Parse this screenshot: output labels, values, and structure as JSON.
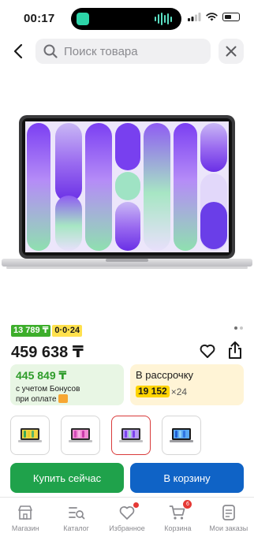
{
  "status_bar": {
    "time": "00:17"
  },
  "search": {
    "placeholder": "Поиск товара",
    "value": ""
  },
  "product": {
    "image_icon": "laptop-image",
    "badges": {
      "bonus_price": "13 789 ₸",
      "installment_plan": "0·0·24"
    },
    "gallery_pages": 2,
    "gallery_current": 1,
    "price": "459 638 ₸",
    "bonus_card": {
      "amount": "445 849 ₸",
      "line1": "с учетом Бонусов",
      "line2": "при оплате"
    },
    "installment_card": {
      "title": "В рассрочку",
      "monthly": "19 152",
      "months": "×24"
    },
    "variants": [
      {
        "name": "variant-1",
        "selected": false
      },
      {
        "name": "variant-2",
        "selected": false
      },
      {
        "name": "variant-3",
        "selected": true
      },
      {
        "name": "variant-4",
        "selected": false
      }
    ]
  },
  "actions": {
    "buy_now": "Купить сейчас",
    "add_to_cart": "В корзину"
  },
  "bottom_nav": [
    {
      "label": "Магазин",
      "icon": "store-icon"
    },
    {
      "label": "Каталог",
      "icon": "catalog-icon"
    },
    {
      "label": "Избранное",
      "icon": "heart-icon",
      "has_dot": true
    },
    {
      "label": "Корзина",
      "icon": "cart-icon",
      "count": "6"
    },
    {
      "label": "Мои заказы",
      "icon": "orders-icon"
    }
  ],
  "colors": {
    "buy_button": "#1fa24b",
    "cart_button": "#0f63c6",
    "bonus_green": "#3dae2b",
    "installment_yellow": "#ffd400",
    "badge_red": "#e53935"
  }
}
